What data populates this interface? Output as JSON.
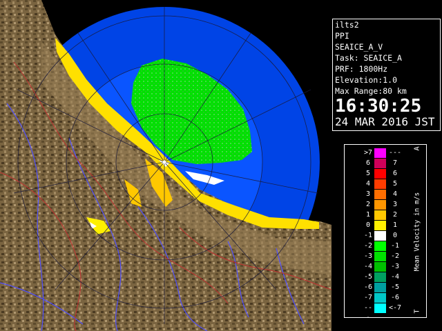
{
  "info": {
    "site": "ilts2",
    "product": "PPI",
    "task_name": "SEAICE_A_V",
    "task": "Task: SEAICE_A",
    "prf": "PRF: 1800Hz",
    "elevation": "Elevation:1.0",
    "max_range": "Max Range:80 km",
    "time": "16:30:25",
    "date": "24 MAR 2016 JST"
  },
  "legend": {
    "unit_label": "Mean Velocity in m/s",
    "top_mark": "A",
    "bottom_mark": "T",
    "rows": [
      {
        "left": ">7",
        "right": "---",
        "color": "#ff00ff"
      },
      {
        "left": "6",
        "right": "7",
        "color": "#d0005a"
      },
      {
        "left": "5",
        "right": "6",
        "color": "#ff0000"
      },
      {
        "left": "4",
        "right": "5",
        "color": "#ff3c00"
      },
      {
        "left": "3",
        "right": "4",
        "color": "#ff6e00"
      },
      {
        "left": "2",
        "right": "3",
        "color": "#ff9600"
      },
      {
        "left": "1",
        "right": "2",
        "color": "#ffc800"
      },
      {
        "left": "0",
        "right": "1",
        "color": "#fff000"
      },
      {
        "left": "-1",
        "right": "0",
        "color": "#ffffff"
      },
      {
        "left": "-2",
        "right": "-1",
        "color": "#00ff00"
      },
      {
        "left": "-3",
        "right": "-2",
        "color": "#00e000"
      },
      {
        "left": "-4",
        "right": "-3",
        "color": "#00c000"
      },
      {
        "left": "-5",
        "right": "-4",
        "color": "#00a060"
      },
      {
        "left": "-6",
        "right": "-5",
        "color": "#00a0a0"
      },
      {
        "left": "-7",
        "right": "-6",
        "color": "#00c8c8"
      },
      {
        "left": "---",
        "right": "<-7",
        "color": "#00ffff"
      }
    ]
  },
  "colors": {
    "sea_inner": "#0a55ff",
    "sea_outer": "#0044e6",
    "land": "#806a44",
    "coast_echo": "#ffe000",
    "sea_ice_echo": "#00e000",
    "river": "#5050ff",
    "boundary": "#c03030"
  }
}
